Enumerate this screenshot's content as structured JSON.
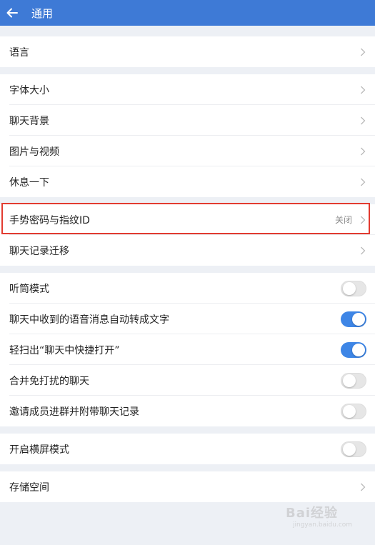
{
  "header": {
    "title": "通用"
  },
  "groups": {
    "language": {
      "label": "语言"
    },
    "display": {
      "font_size": "字体大小",
      "chat_background": "聊天背景",
      "photos_videos": "图片与视频",
      "take_break": "休息一下"
    },
    "security": {
      "gesture_password": "手势密码与指纹ID",
      "gesture_value": "关闭",
      "chat_migration": "聊天记录迁移"
    },
    "toggles": [
      {
        "label": "听筒模式",
        "on": false
      },
      {
        "label": "聊天中收到的语音消息自动转成文字",
        "on": true
      },
      {
        "label": "轻扫出“聊天中快捷打开”",
        "on": true
      },
      {
        "label": "合并免打扰的聊天",
        "on": false
      },
      {
        "label": "邀请成员进群并附带聊天记录",
        "on": false
      }
    ],
    "landscape": {
      "label": "开启横屏模式",
      "on": false
    },
    "storage": {
      "label": "存储空间"
    }
  },
  "colors": {
    "header": "#3e7ad6",
    "toggle_on": "#3e86e6",
    "highlight": "#e23b30"
  },
  "watermark": {
    "logo": "Bai经验",
    "sub": "jingyan.baidu.com"
  }
}
